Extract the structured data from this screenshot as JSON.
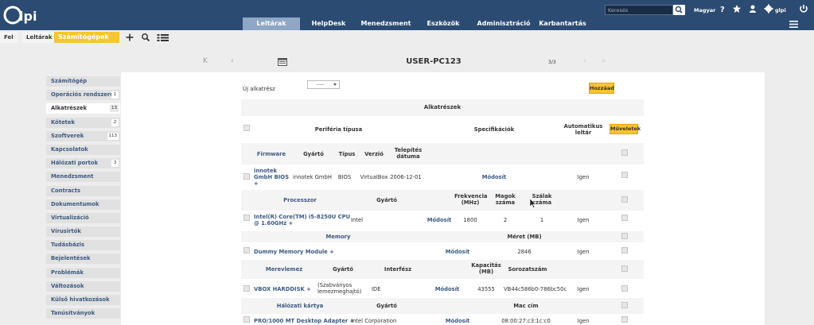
{
  "header": {
    "logo_text": "Glpi",
    "search_placeholder": "Keresés",
    "language": "Magyar",
    "user": "glpi",
    "icons": [
      "search-icon",
      "help-icon",
      "star-icon",
      "reservation-icon",
      "gear-icon",
      "logout-icon"
    ]
  },
  "menu": [
    "Leltárak",
    "HelpDesk",
    "Menedzsment",
    "Eszközök",
    "Adminisztráció",
    "Karbantartás"
  ],
  "breadcrumb": [
    "Fel",
    "Leltárak",
    "Számítógépek"
  ],
  "nav": {
    "title": "USER-PC123",
    "count": "3/3",
    "first": "K",
    "prev": "‹",
    "next": "›",
    "last": "»"
  },
  "sidebar": [
    {
      "label": "Számítógép",
      "badge": ""
    },
    {
      "label": "Operációs rendszerek",
      "badge": "1"
    },
    {
      "label": "Alkatrészek",
      "badge": "13"
    },
    {
      "label": "Kötetek",
      "badge": "2"
    },
    {
      "label": "Szoftverek",
      "badge": "113"
    },
    {
      "label": "Kapcsolatok",
      "badge": ""
    },
    {
      "label": "Hálózati portok",
      "badge": "3"
    },
    {
      "label": "Menedzsment",
      "badge": ""
    },
    {
      "label": "Contracts",
      "badge": ""
    },
    {
      "label": "Dokumentumok",
      "badge": ""
    },
    {
      "label": "Virtualizáció",
      "badge": ""
    },
    {
      "label": "Vírusirtók",
      "badge": ""
    },
    {
      "label": "Tudásbázis",
      "badge": ""
    },
    {
      "label": "Bejelentések",
      "badge": ""
    },
    {
      "label": "Problémák",
      "badge": ""
    },
    {
      "label": "Változások",
      "badge": ""
    },
    {
      "label": "Külső hivatkozások",
      "badge": ""
    },
    {
      "label": "Tanúsítványok",
      "badge": ""
    }
  ],
  "form": {
    "new_label": "Új alkatrész",
    "select_value": "-----",
    "add_button": "Hozzáad"
  },
  "table": {
    "title": "Alkatrészek",
    "header": {
      "peripheral_type": "Periféria típusa",
      "specs": "Specifikációk",
      "auto": "Automatikus leltár",
      "actions": "Műveletek"
    },
    "firmware": {
      "section": "Firmware",
      "cols": [
        "Gyártó",
        "Típus",
        "Verzió",
        "Telepítés dátuma"
      ],
      "name": "innotek GmbH BIOS",
      "plus": "+",
      "values": [
        "innotek GmbH",
        "BIOS",
        "VirtualBox",
        "2006-12-01"
      ],
      "edit": "Módosít",
      "auto": "Igen"
    },
    "processor": {
      "section": "Processzor",
      "cols": [
        "Gyártó",
        "Frekvencia (MHz)",
        "Magok száma",
        "Szálak száma"
      ],
      "name": "Intel(R) Core(TM) i5-8250U CPU @ 1.60GHz",
      "plus": "+",
      "values": [
        "Intel",
        "1800",
        "2",
        "1"
      ],
      "edit": "Módosít",
      "auto": "Igen"
    },
    "memory": {
      "section": "Memory",
      "cols": [
        "Méret (MB)"
      ],
      "name": "Dummy Memory Module",
      "plus": "+",
      "values": [
        "2846"
      ],
      "edit": "Módosít",
      "auto": "Igen"
    },
    "harddisk": {
      "section": "Merevlemez",
      "cols": [
        "Gyártó",
        "Interfész",
        "Kapacitás (MB)",
        "Sorozatszám"
      ],
      "name": "VBOX HARDDISK",
      "plus": "+",
      "values": [
        "(Szabványos lemezmeghajtó)",
        "IDE",
        "43555",
        "VB44c586b0-786bc50c"
      ],
      "edit": "Módosít",
      "auto": "Igen"
    },
    "network": {
      "section": "Hálózati kártya",
      "cols": [
        "Gyártó",
        "Mac cím"
      ],
      "name": "PRO/1000 MT Desktop Adapter",
      "plus": "+",
      "values": [
        "Intel Corporation",
        "08:00:27:c3:1c:c0"
      ],
      "edit": "Módosít",
      "auto": "Igen"
    }
  }
}
